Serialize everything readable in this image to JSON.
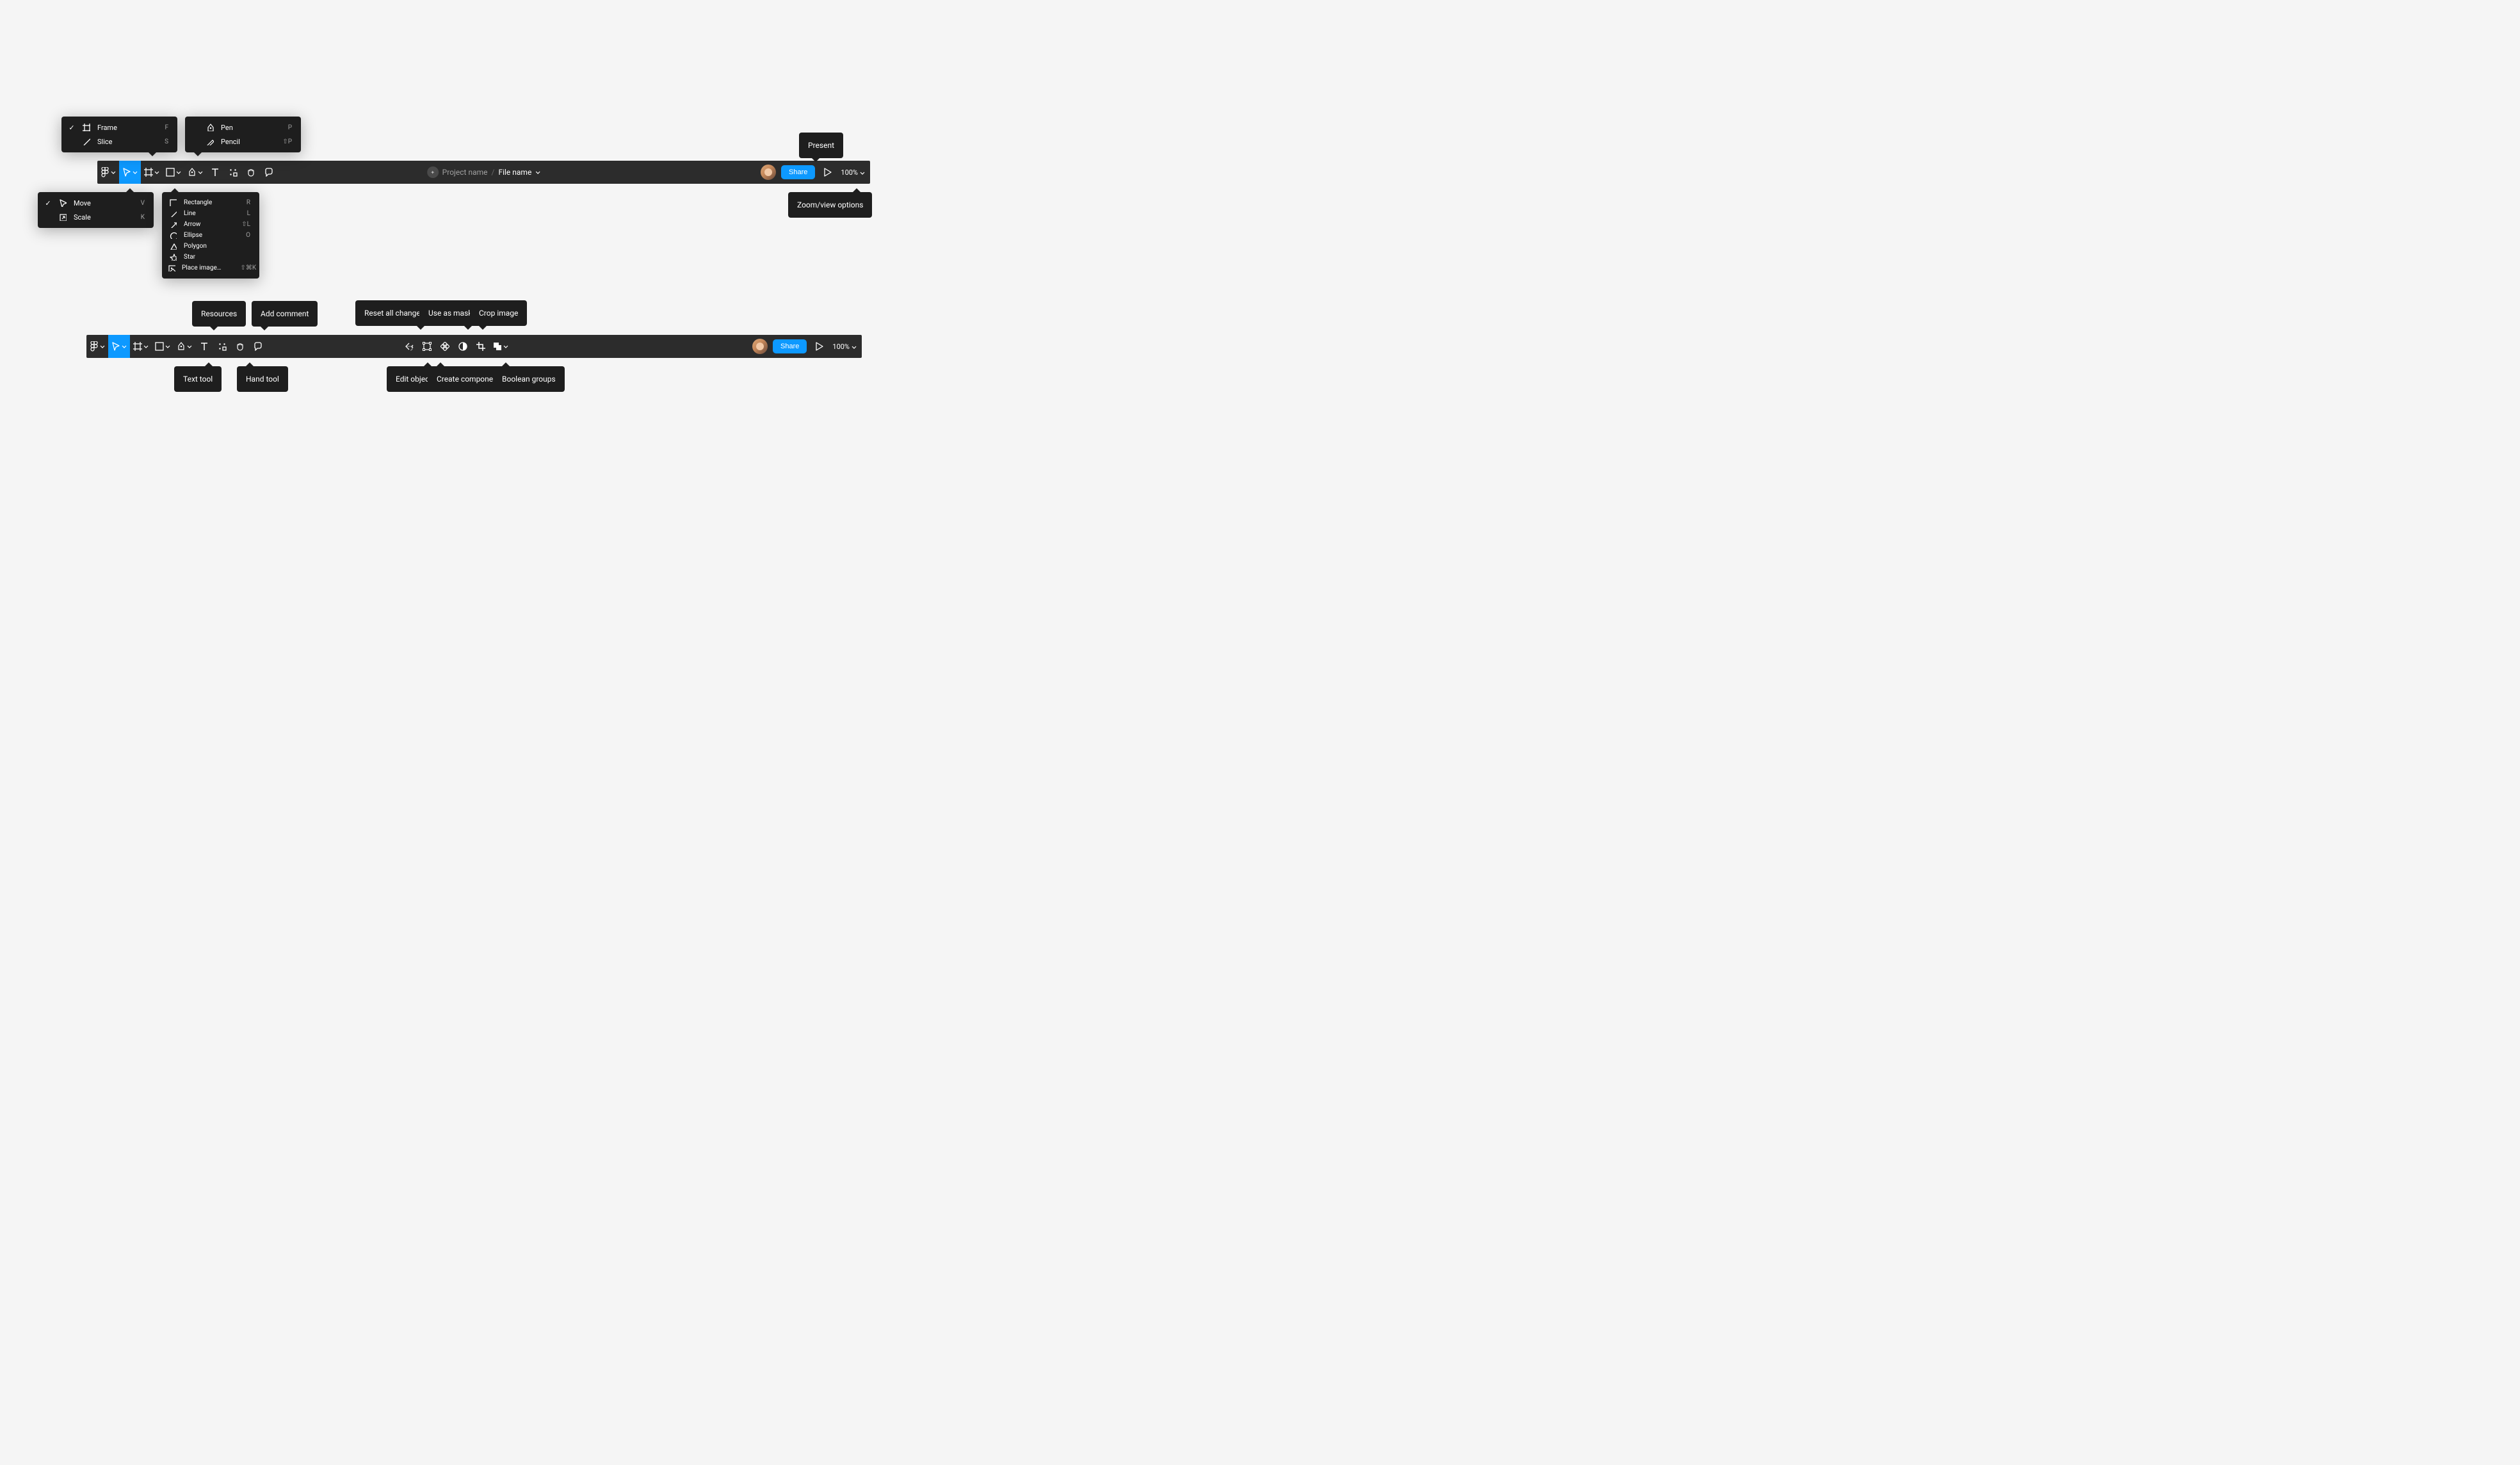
{
  "toolbar1": {
    "project_name": "Project name",
    "file_name": "File name",
    "share_label": "Share",
    "zoom_label": "100%"
  },
  "toolbar2": {
    "share_label": "Share",
    "zoom_label": "100%"
  },
  "menus": {
    "move": {
      "items": [
        {
          "label": "Move",
          "shortcut": "V",
          "checked": true
        },
        {
          "label": "Scale",
          "shortcut": "K",
          "checked": false
        }
      ]
    },
    "frame": {
      "items": [
        {
          "label": "Frame",
          "shortcut": "F",
          "checked": true
        },
        {
          "label": "Slice",
          "shortcut": "S",
          "checked": false
        }
      ]
    },
    "pen": {
      "items": [
        {
          "label": "Pen",
          "shortcut": "P"
        },
        {
          "label": "Pencil",
          "shortcut": "⇧P"
        }
      ]
    },
    "shape": {
      "items": [
        {
          "label": "Rectangle",
          "shortcut": "R"
        },
        {
          "label": "Line",
          "shortcut": "L"
        },
        {
          "label": "Arrow",
          "shortcut": "⇧L"
        },
        {
          "label": "Ellipse",
          "shortcut": "O"
        },
        {
          "label": "Polygon",
          "shortcut": ""
        },
        {
          "label": "Star",
          "shortcut": ""
        },
        {
          "label": "Place image…",
          "shortcut": "⇧⌘K"
        }
      ]
    }
  },
  "tooltips": {
    "present": "Present",
    "zoom_view_options": "Zoom/view options",
    "resources": "Resources",
    "add_comment": "Add comment",
    "text_tool": "Text tool",
    "hand_tool": "Hand tool",
    "reset_all_changes": "Reset all changes",
    "use_as_mask": "Use as mask",
    "crop_image": "Crop image",
    "edit_object": "Edit object",
    "create_component": "Create component",
    "boolean_groups": "Boolean groups"
  }
}
